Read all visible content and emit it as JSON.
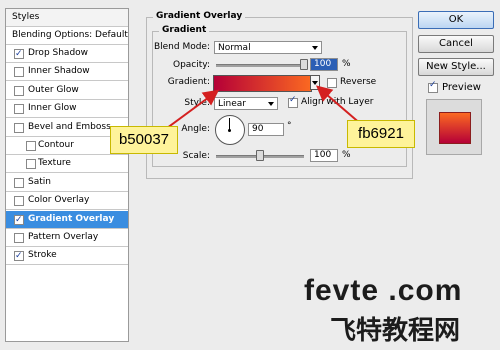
{
  "styles_panel": {
    "header": "Styles",
    "blending": "Blending Options: Default",
    "items": [
      {
        "label": "Drop Shadow",
        "checked": true
      },
      {
        "label": "Inner Shadow",
        "checked": false
      },
      {
        "label": "Outer Glow",
        "checked": false
      },
      {
        "label": "Inner Glow",
        "checked": false
      },
      {
        "label": "Bevel and Emboss",
        "checked": false
      },
      {
        "label": "Contour",
        "checked": false
      },
      {
        "label": "Texture",
        "checked": false
      },
      {
        "label": "Satin",
        "checked": false
      },
      {
        "label": "Color Overlay",
        "checked": false
      },
      {
        "label": "Gradient Overlay",
        "checked": true,
        "selected": true
      },
      {
        "label": "Pattern Overlay",
        "checked": false
      },
      {
        "label": "Stroke",
        "checked": true
      }
    ]
  },
  "overlay": {
    "title": "Gradient Overlay",
    "group_title": "Gradient",
    "blend_mode_label": "Blend Mode:",
    "blend_mode_value": "Normal",
    "opacity_label": "Opacity:",
    "opacity_value": "100",
    "opacity_unit": "%",
    "opacity_level": 1.0,
    "gradient_label": "Gradient:",
    "gradient_start": "#b50037",
    "gradient_end": "#fb6921",
    "reverse_label": "Reverse",
    "reverse_checked": false,
    "style_label": "Style:",
    "style_value": "Linear",
    "align_label": "Align with Layer",
    "align_checked": true,
    "angle_label": "Angle:",
    "angle_value": "90",
    "angle_unit": "°",
    "scale_label": "Scale:",
    "scale_value": "100",
    "scale_unit": "%",
    "scale_level": 0.5
  },
  "buttons": {
    "ok": "OK",
    "cancel": "Cancel",
    "new_style": "New Style...",
    "preview": "Preview",
    "preview_checked": true
  },
  "annotations": {
    "left": "b50037",
    "right": "fb6921"
  },
  "watermark": {
    "line1": "fevte .com",
    "line2": "飞特教程网"
  }
}
